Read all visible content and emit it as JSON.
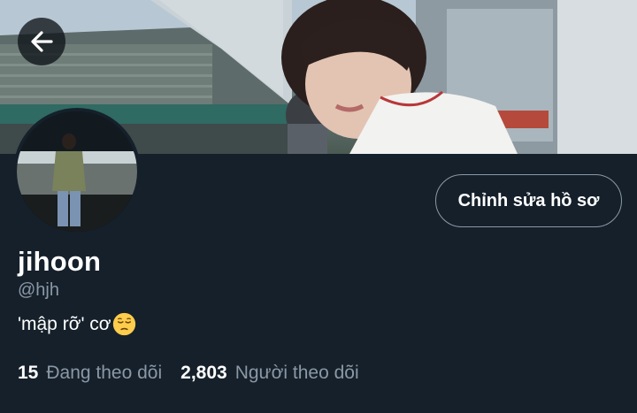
{
  "header": {
    "banner_icon": "stadium-photo",
    "back_icon": "arrow-left-icon"
  },
  "profile": {
    "avatar_icon": "profile-photo",
    "edit_button_label": "Chỉnh sửa hồ sơ",
    "display_name": "jihoon",
    "handle": "@hjh",
    "bio_text": "'mập rỡ' cơ",
    "bio_emoji": "pensive-face-emoji"
  },
  "stats": {
    "following_count": "15",
    "following_label": "Đang theo dõi",
    "followers_count": "2,803",
    "followers_label": "Người theo dõi"
  },
  "colors": {
    "background": "#15202b",
    "secondary_text": "#8b98a5",
    "primary_text": "#ffffff"
  }
}
